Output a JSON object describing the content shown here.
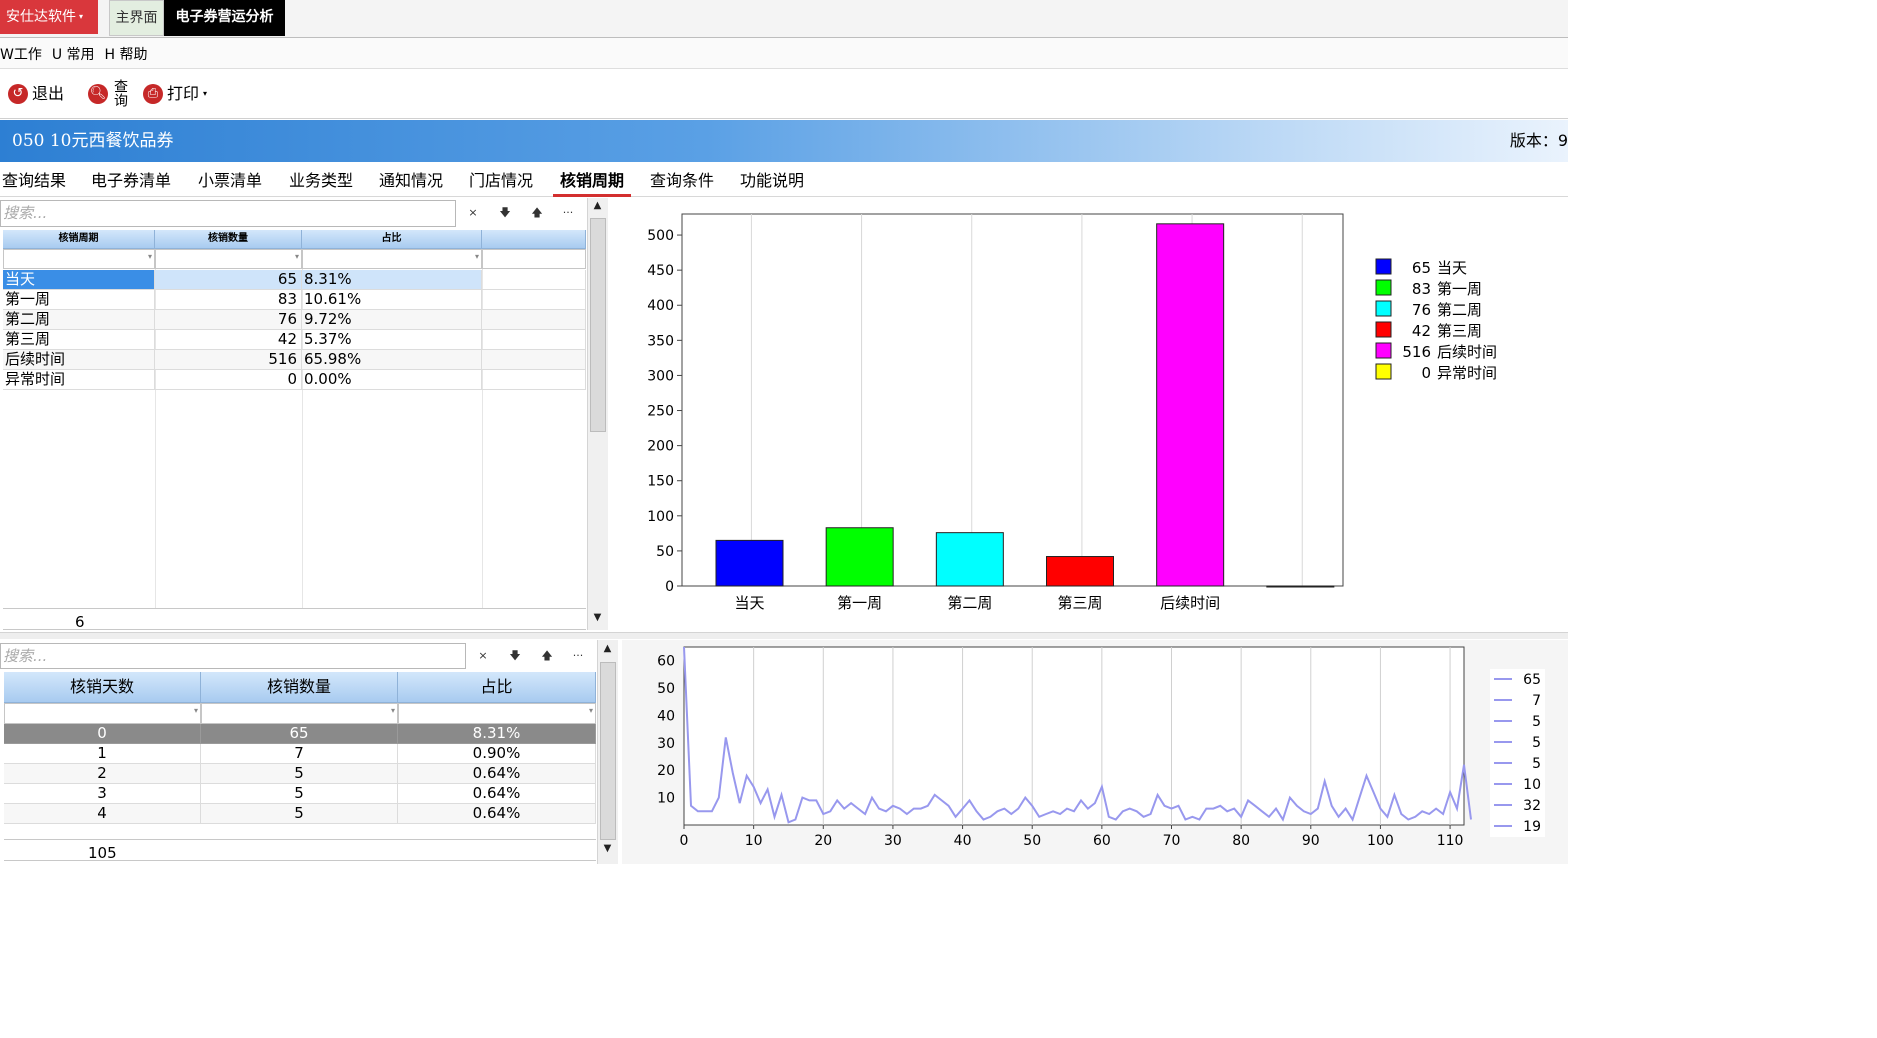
{
  "app": {
    "brand": "安仕达软件",
    "tabs": [
      {
        "label": "主界面"
      },
      {
        "label": "电子券营运分析"
      }
    ]
  },
  "menu": [
    {
      "label": "W工作"
    },
    {
      "label": "U 常用"
    },
    {
      "label": "H 帮助"
    }
  ],
  "toolbar": {
    "exit": "退出",
    "query": "查询",
    "print": "打印"
  },
  "header": {
    "title": "050  10元西餐饮品券",
    "version_label": "版本：9"
  },
  "tabs": [
    "查询结果",
    "电子券清单",
    "小票清单",
    "业务类型",
    "通知情况",
    "门店情况",
    "核销周期",
    "查询条件",
    "功能说明"
  ],
  "active_tab": "核销周期",
  "grid1": {
    "search_placeholder": "搜索...",
    "tools": [
      "×",
      "🡇",
      "🡅",
      "···"
    ],
    "columns": [
      "核销周期",
      "核销数量",
      "占比",
      ""
    ],
    "rows": [
      [
        "当天",
        "65",
        "8.31%"
      ],
      [
        "第一周",
        "83",
        "10.61%"
      ],
      [
        "第二周",
        "76",
        "9.72%"
      ],
      [
        "第三周",
        "42",
        "5.37%"
      ],
      [
        "后续时间",
        "516",
        "65.98%"
      ],
      [
        "异常时间",
        "0",
        "0.00%"
      ]
    ],
    "footer_count": "6"
  },
  "grid2": {
    "search_placeholder": "搜索...",
    "tools": [
      "×",
      "🡇",
      "🡅",
      "···"
    ],
    "columns": [
      "核销天数",
      "核销数量",
      "占比"
    ],
    "rows": [
      [
        "0",
        "65",
        "8.31%"
      ],
      [
        "1",
        "7",
        "0.90%"
      ],
      [
        "2",
        "5",
        "0.64%"
      ],
      [
        "3",
        "5",
        "0.64%"
      ],
      [
        "4",
        "5",
        "0.64%"
      ]
    ],
    "footer_count": "105"
  },
  "chart_data": [
    {
      "type": "bar",
      "categories": [
        "当天",
        "第一周",
        "第二周",
        "第三周",
        "后续时间",
        "异常时间"
      ],
      "values": [
        65,
        83,
        76,
        42,
        516,
        0
      ],
      "colors": [
        "#0000ff",
        "#00ff00",
        "#00ffff",
        "#ff0000",
        "#ff00ff",
        "#ffff00"
      ],
      "ylim": [
        0,
        530
      ],
      "yticks": [
        0,
        50,
        100,
        150,
        200,
        250,
        300,
        350,
        400,
        450,
        500
      ],
      "x_tick_labels": [
        "当天",
        "第一周",
        "第二周",
        "第三周",
        "后续时间",
        ""
      ],
      "legend": [
        {
          "label": "65 当天"
        },
        {
          "label": "83 第一周"
        },
        {
          "label": "76 第二周"
        },
        {
          "label": "42 第三周"
        },
        {
          "label": "516 后续时间"
        },
        {
          "label": "0 异常时间"
        }
      ],
      "legend_position": "right",
      "grid": true
    },
    {
      "type": "line",
      "color": "#9898ee",
      "xlim": [
        0,
        112
      ],
      "ylim": [
        0,
        65
      ],
      "xticks": [
        0,
        10,
        20,
        30,
        40,
        50,
        60,
        70,
        80,
        90,
        100,
        110
      ],
      "yticks": [
        10,
        20,
        30,
        40,
        50,
        60
      ],
      "values": [
        65,
        7,
        5,
        5,
        5,
        10,
        32,
        19,
        8,
        18,
        14,
        8,
        13,
        3,
        11,
        1,
        2,
        10,
        9,
        9,
        4,
        5,
        9,
        6,
        8,
        6,
        4,
        10,
        6,
        5,
        7,
        6,
        4,
        6,
        6,
        7,
        11,
        9,
        7,
        3,
        6,
        9,
        5,
        2,
        3,
        5,
        6,
        4,
        6,
        10,
        7,
        3,
        4,
        5,
        4,
        6,
        5,
        9,
        6,
        8,
        14,
        3,
        2,
        5,
        6,
        5,
        3,
        4,
        11,
        7,
        6,
        7,
        2,
        3,
        2,
        6,
        6,
        7,
        5,
        6,
        3,
        9,
        7,
        5,
        3,
        6,
        2,
        10,
        7,
        5,
        4,
        6,
        16,
        7,
        3,
        6,
        2,
        10,
        18,
        12,
        6,
        3,
        11,
        4,
        2,
        3,
        5,
        4,
        6,
        4,
        12,
        6,
        22,
        2
      ],
      "legend": [
        "65",
        "7",
        "5",
        "5",
        "5",
        "10",
        "32",
        "19"
      ],
      "legend_position": "right",
      "grid": true
    }
  ],
  "colors": {
    "brand": "#d9373c",
    "banner": "#2d7fd3",
    "grid_header": "#a8cbf0",
    "selected_row": "#3a8ee6",
    "grid2_selected_row": "#8a8a8a",
    "active_tab_underline": "#d32f2f"
  },
  "icons": {
    "exit": "exit-icon",
    "query": "search-icon",
    "print": "printer-icon"
  }
}
